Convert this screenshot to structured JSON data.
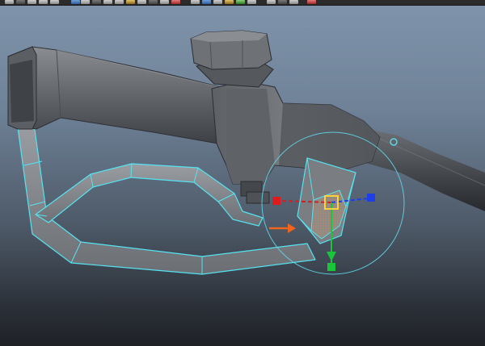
{
  "app": {
    "name": "3D viewport",
    "icon_semantics": "maya-status-line"
  },
  "shelf": {
    "icons": [
      "new-scene-icon",
      "open-scene-icon",
      "save-scene-icon",
      "undo-icon",
      "redo-icon",
      "select-hierarchy-icon",
      "select-object-icon",
      "select-component-icon",
      "snap-grid-icon",
      "snap-curve-icon",
      "snap-point-icon",
      "snap-plane-icon",
      "construction-history-icon",
      "render-frame-icon",
      "ipr-render-icon",
      "render-settings-icon",
      "sphere-icon",
      "cube-icon",
      "cylinder-icon",
      "light-icon",
      "shader-icon",
      "move-tool-icon",
      "rotate-tool-icon",
      "scale-tool-icon",
      "lasso-icon"
    ]
  },
  "colors": {
    "viewport_top": "#7f93aa",
    "viewport_bottom": "#1e2126",
    "mesh_fill": "#7c7f84",
    "mesh_dark": "#4b4e54",
    "wireframe_selected": "#56e3f0",
    "axis_x": "#e01b1b",
    "axis_y": "#19c63b",
    "axis_z": "#1f3fe6",
    "pivot_center": "#ffd23a",
    "annotation_arrow": "#f0641c",
    "rotate_ring": "#5fd5e6"
  },
  "viewport": {
    "object": "fuel-nozzle-mesh",
    "selection": "trigger-face",
    "manipulator": "move-tool-manipulator",
    "soft_select_ring": true
  }
}
